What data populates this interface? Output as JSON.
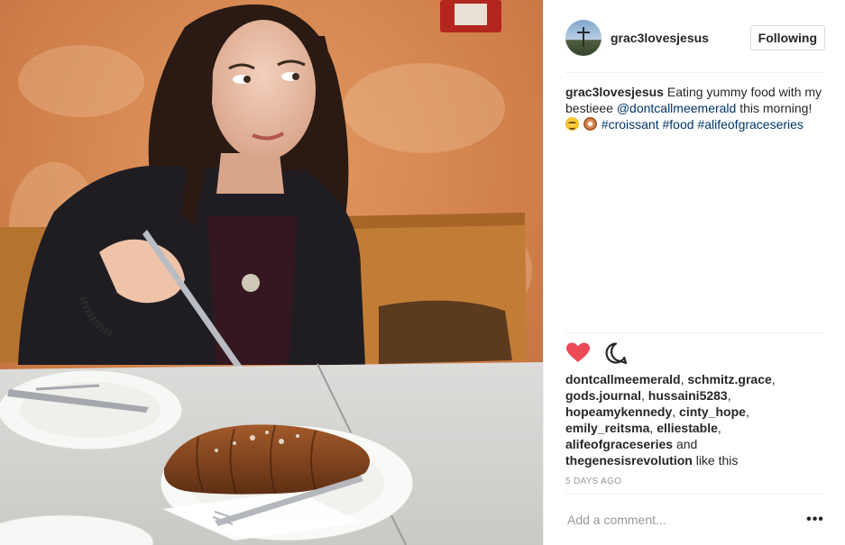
{
  "post": {
    "username": "grac3lovesjesus",
    "follow_label": "Following",
    "caption": {
      "username": "grac3lovesjesus",
      "text_before": " Eating yummy food with my bestieee ",
      "mention": "@dontcallmeemerald",
      "text_after": " this morning! ",
      "emojis": [
        "smiling-face",
        "doughnut"
      ],
      "hashtags": [
        "#croissant",
        "#food",
        "#alifeofgraceseries"
      ]
    },
    "liked": true,
    "likes": {
      "names": [
        "dontcallmeemerald",
        "schmitz.grace",
        "gods.journal",
        "hussaini5283",
        "hopeamykennedy",
        "cinty_hope",
        "emily_reitsma",
        "elliestable",
        "alifeofgraceseries",
        "thegenesisrevolution"
      ],
      "and_word": "and",
      "suffix": "like this"
    },
    "timestamp": "5 DAYS AGO",
    "comment_placeholder": "Add a comment...",
    "more_label": "•••"
  },
  "colors": {
    "heart": "#ed4956",
    "link": "#003569",
    "muted": "#999999"
  },
  "icons": {
    "like": "heart-icon",
    "comment": "comment-icon",
    "more": "more-options-icon"
  }
}
